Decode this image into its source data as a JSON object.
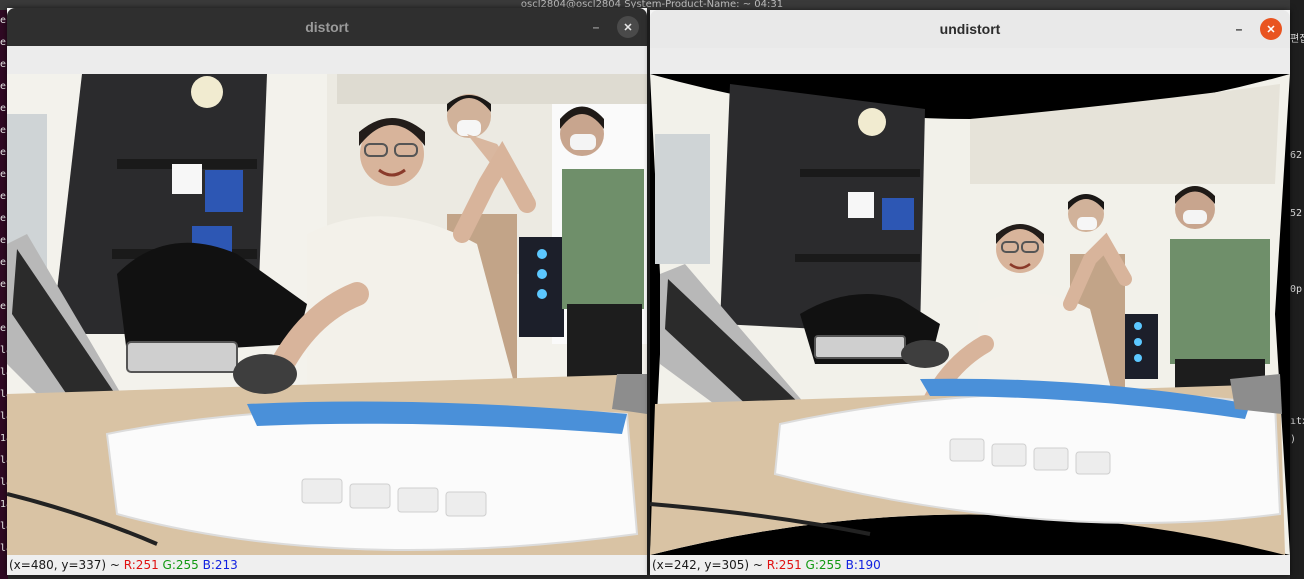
{
  "desktop": {
    "top_bar_text": "oscl2804@oscl2804 System-Product-Name: ~ 04:31",
    "left_terminal_chars": [
      "e",
      "e",
      "e",
      "e",
      "e",
      "e",
      "e",
      "e",
      "e",
      "e",
      "e",
      "e",
      "e",
      "e",
      "e",
      "la",
      "la",
      "la",
      "la",
      "1a",
      "la",
      "la",
      "1a",
      "la",
      "la"
    ],
    "right_terminal": {
      "korean_line": "편집  파일  보기  검색  터미널  도움말",
      "snippets": [
        "62",
        "52",
        "0p",
        "ıtx",
        ")"
      ]
    }
  },
  "windows": [
    {
      "title": "distort",
      "state": "inactive",
      "minimize_glyph": "–",
      "close_glyph": "✕",
      "status": {
        "coords": "(x=480, y=337) ~ ",
        "r": "R:251",
        "g": "G:255",
        "b": "B:213"
      }
    },
    {
      "title": "undistort",
      "state": "active",
      "minimize_glyph": "–",
      "close_glyph": "✕",
      "status": {
        "coords": "(x=242, y=305) ~ ",
        "r": "R:251",
        "g": "G:255",
        "b": "B:190"
      }
    }
  ],
  "colors": {
    "accent_close": "#e95420",
    "keyboard_stripe": "#4a90d9",
    "shirt_green": "#6f8f6a"
  }
}
